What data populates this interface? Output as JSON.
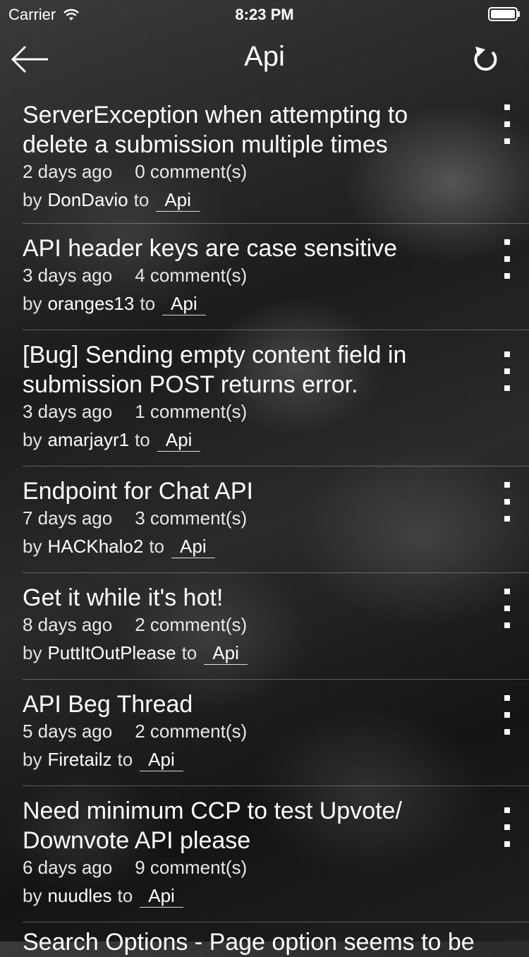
{
  "status_bar": {
    "carrier": "Carrier",
    "time": "8:23 PM"
  },
  "nav": {
    "title": "Api"
  },
  "labels": {
    "by": "by",
    "to": "to"
  },
  "posts": [
    {
      "title": "ServerException when attempting to delete a submission multiple times",
      "ago": "2 days ago",
      "comments": "0 comment(s)",
      "author": "DonDavio",
      "channel": "Api"
    },
    {
      "title": "API header keys are case sensitive",
      "ago": "3 days ago",
      "comments": "4 comment(s)",
      "author": "oranges13",
      "channel": "Api"
    },
    {
      "title": "[Bug] Sending empty content field in submission POST returns error.",
      "ago": "3 days ago",
      "comments": "1 comment(s)",
      "author": "amarjayr1",
      "channel": "Api"
    },
    {
      "title": "Endpoint for Chat API",
      "ago": "7 days ago",
      "comments": "3 comment(s)",
      "author": "HACKhalo2",
      "channel": "Api"
    },
    {
      "title": "Get it while it's hot!",
      "ago": "8 days ago",
      "comments": "2 comment(s)",
      "author": "PuttItOutPlease",
      "channel": "Api"
    },
    {
      "title": "API Beg Thread",
      "ago": "5 days ago",
      "comments": "2 comment(s)",
      "author": "Firetailz",
      "channel": "Api"
    },
    {
      "title": "Need minimum CCP to test Upvote/ Downvote API please",
      "ago": "6 days ago",
      "comments": "9 comment(s)",
      "author": "nuudles",
      "channel": "Api"
    }
  ],
  "partial_post": {
    "title": "Search Options - Page option seems to be"
  }
}
